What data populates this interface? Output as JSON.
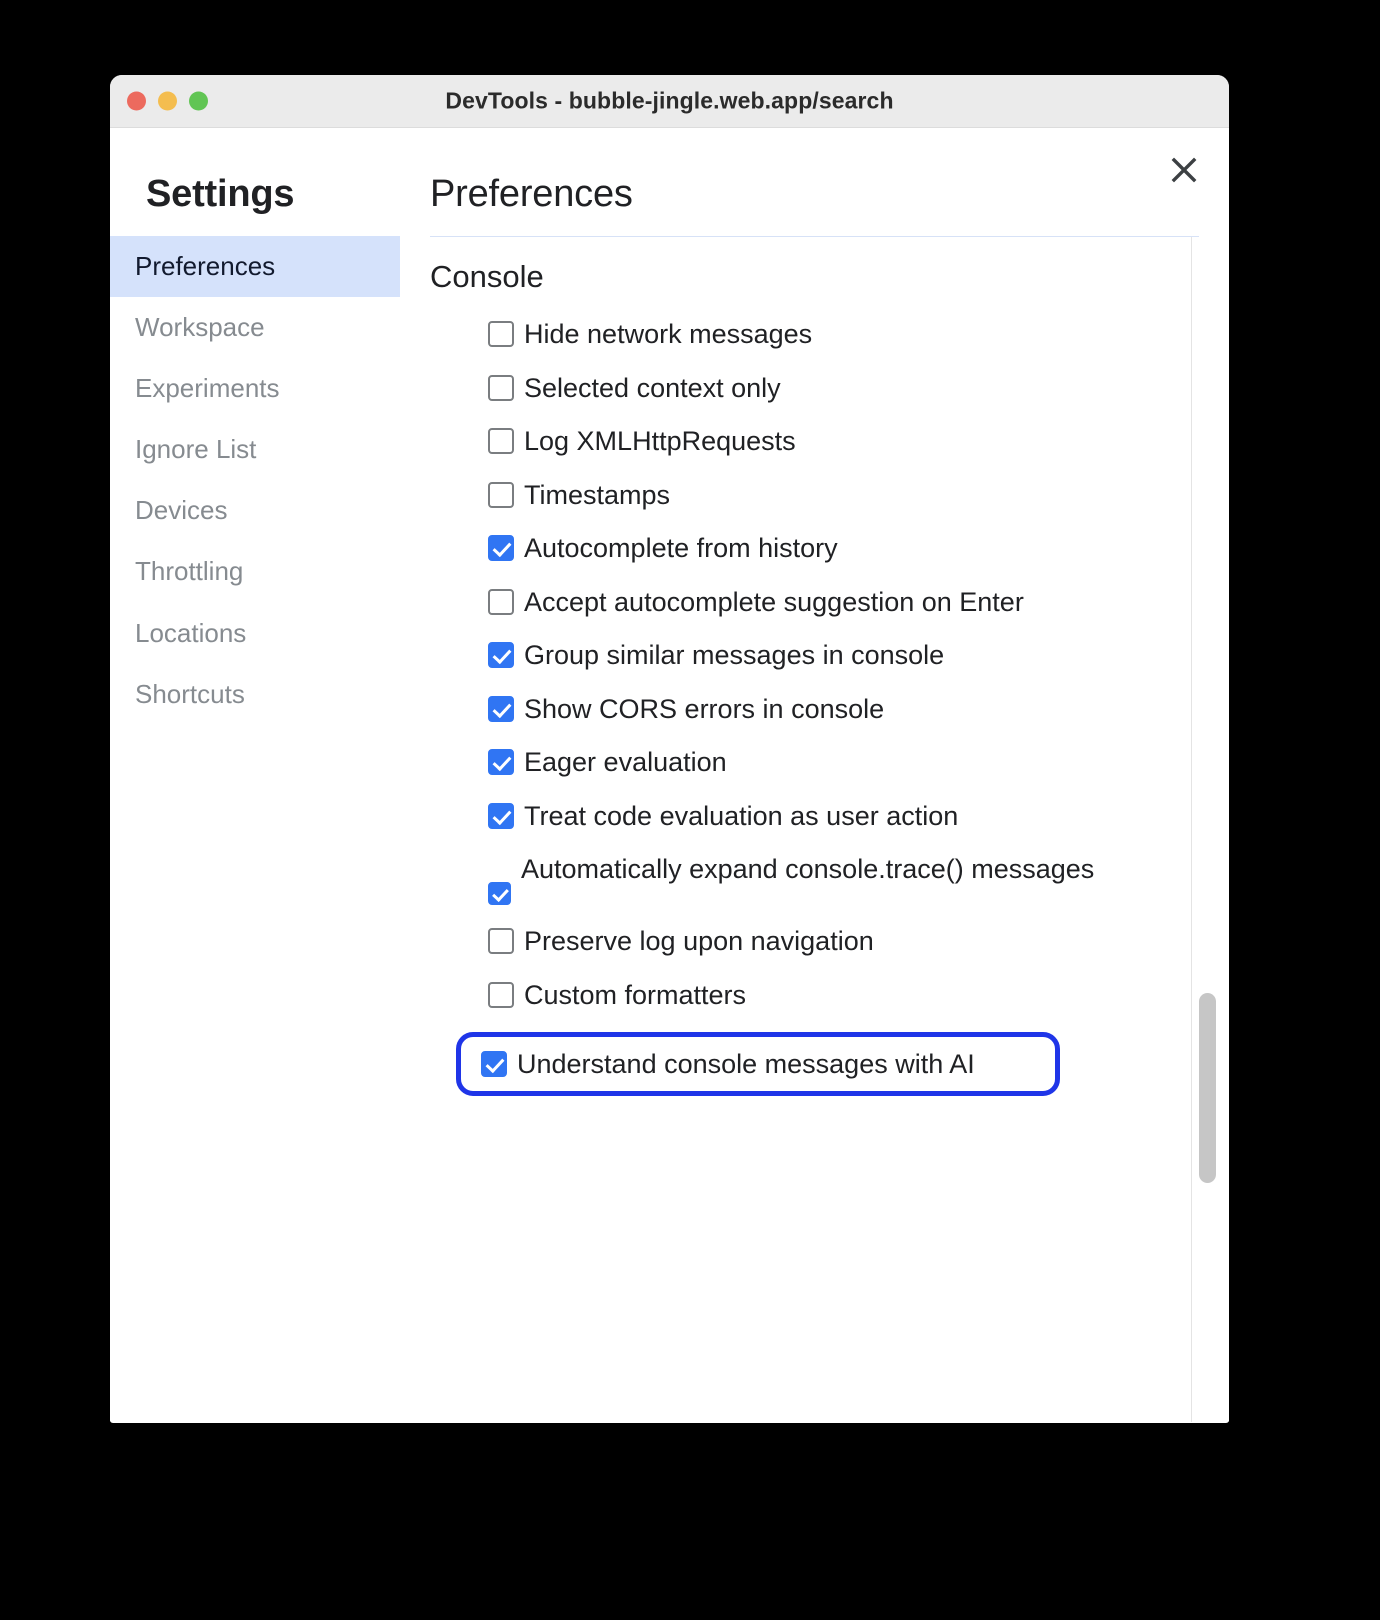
{
  "window": {
    "title": "DevTools - bubble-jingle.web.app/search",
    "traffic_lights": [
      {
        "name": "close",
        "color": "#ec6a5e"
      },
      {
        "name": "minimize",
        "color": "#f4bd4f"
      },
      {
        "name": "maximize",
        "color": "#61c554"
      }
    ]
  },
  "dialog": {
    "close_icon": "close-icon",
    "sidebar": {
      "title": "Settings",
      "items": [
        {
          "label": "Preferences",
          "selected": true
        },
        {
          "label": "Workspace",
          "selected": false
        },
        {
          "label": "Experiments",
          "selected": false
        },
        {
          "label": "Ignore List",
          "selected": false
        },
        {
          "label": "Devices",
          "selected": false
        },
        {
          "label": "Throttling",
          "selected": false
        },
        {
          "label": "Locations",
          "selected": false
        },
        {
          "label": "Shortcuts",
          "selected": false
        }
      ]
    },
    "content": {
      "title": "Preferences",
      "sections": [
        {
          "heading": "Console",
          "options": [
            {
              "label": "Hide network messages",
              "checked": false
            },
            {
              "label": "Selected context only",
              "checked": false
            },
            {
              "label": "Log XMLHttpRequests",
              "checked": false
            },
            {
              "label": "Timestamps",
              "checked": false
            },
            {
              "label": "Autocomplete from history",
              "checked": true
            },
            {
              "label": "Accept autocomplete suggestion on Enter",
              "checked": false
            },
            {
              "label": "Group similar messages in console",
              "checked": true
            },
            {
              "label": "Show CORS errors in console",
              "checked": true
            },
            {
              "label": "Eager evaluation",
              "checked": true
            },
            {
              "label": "Treat code evaluation as user action",
              "checked": true
            },
            {
              "label": "Automatically expand console.trace() messages",
              "checked": true,
              "multiline": true
            },
            {
              "label": "Preserve log upon navigation",
              "checked": false
            },
            {
              "label": "Custom formatters",
              "checked": false
            },
            {
              "label": "Understand console messages with AI",
              "checked": true,
              "highlighted": true
            }
          ]
        }
      ]
    },
    "scrollbar": {
      "thumb_position": "bottom"
    }
  },
  "colors": {
    "accent": "#3075f3",
    "highlight_ring": "#1f35e8",
    "selected_nav_bg": "#d5e2fb",
    "titlebar_bg": "#ebebeb"
  }
}
